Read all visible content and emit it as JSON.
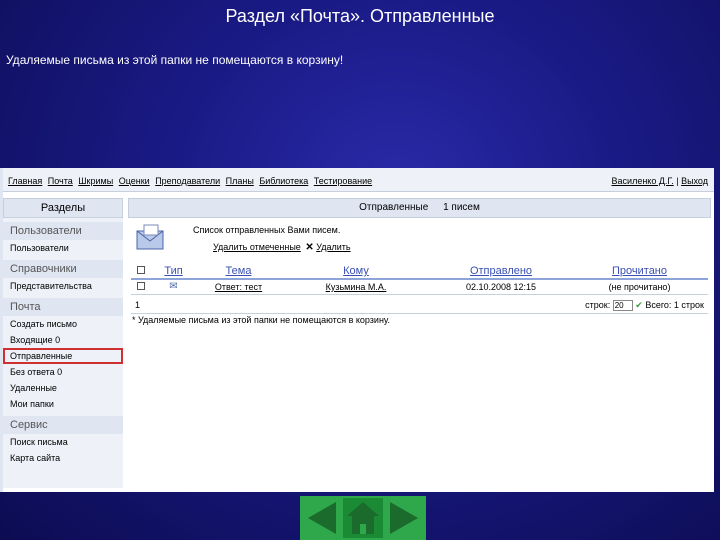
{
  "slide": {
    "title": "Раздел «Почта». Отправленные",
    "note": "Удаляемые письма из этой папки не помещаются в корзину!"
  },
  "topnav": {
    "links": [
      "Главная",
      "Почта",
      "Шкримы",
      "Оценки",
      "Преподаватели",
      "Планы",
      "Библиотека",
      "Тестирование"
    ],
    "user": "Василенко Д.Г.",
    "logout": "Выход"
  },
  "sidebar": {
    "title": "Разделы",
    "groups": [
      {
        "label": "Пользователи",
        "items": [
          "Пользователи"
        ]
      },
      {
        "label": "Справочники",
        "items": [
          "Представительства"
        ]
      },
      {
        "label": "Почта",
        "items": [
          "Создать письмо",
          "Входящие 0",
          "Отправленные",
          "Без ответа 0",
          "Удаленные",
          "Мои папки"
        ]
      },
      {
        "label": "Сервис",
        "items": [
          "Поиск письма",
          "Карта сайта"
        ]
      }
    ],
    "active": "Отправленные"
  },
  "main": {
    "header_folder": "Отправленные",
    "header_count": "1 писем",
    "description": "Список отправленных Вами писем.",
    "action_delete": "Удалить отмеченные",
    "action_clear": "Удалить",
    "columns": [
      "Тип",
      "Тема",
      "Кому",
      "Отправлено",
      "Прочитано"
    ],
    "rows": [
      {
        "subject": "Ответ: тест",
        "to": "Кузьмина М.А.",
        "sent": "02.10.2008 12:15",
        "read": "(не прочитано)"
      }
    ],
    "pager": {
      "page": "1",
      "rows_label": "строк:",
      "rows_value": "20",
      "total": "Всего: 1 строк"
    },
    "footer_note": "* Удаляемые письма из этой папки не помещаются в корзину."
  },
  "colors": {
    "slide_bg": "#1a1a86",
    "nav_green": "#2ea84a",
    "active_outline": "#d03030"
  }
}
